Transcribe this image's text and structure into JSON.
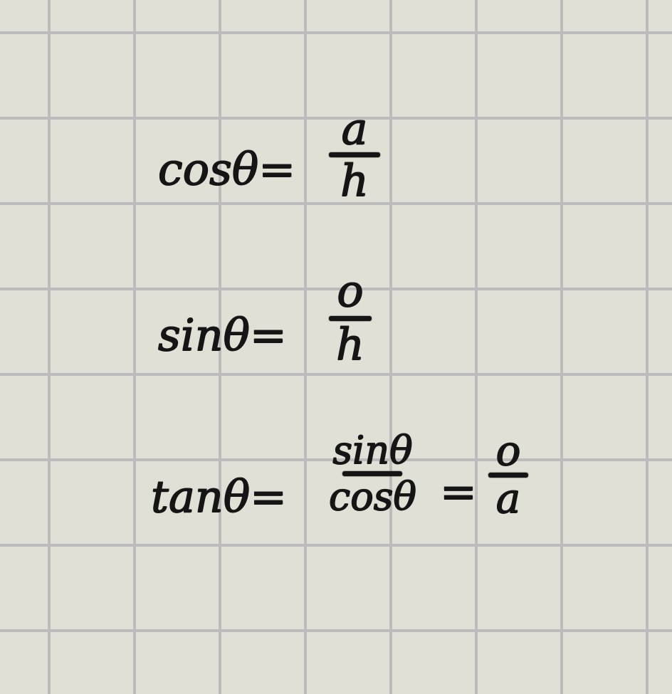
{
  "formulas": {
    "cos": {
      "lhs": "cosθ=",
      "numerator": "a",
      "denominator": "h"
    },
    "sin": {
      "lhs": "sinθ=",
      "numerator": "o",
      "denominator": "h"
    },
    "tan": {
      "lhs": "tanθ=",
      "numerator": "sinθ",
      "denominator": "cosθ",
      "equals": "=",
      "numerator2": "o",
      "denominator2": "a"
    }
  }
}
